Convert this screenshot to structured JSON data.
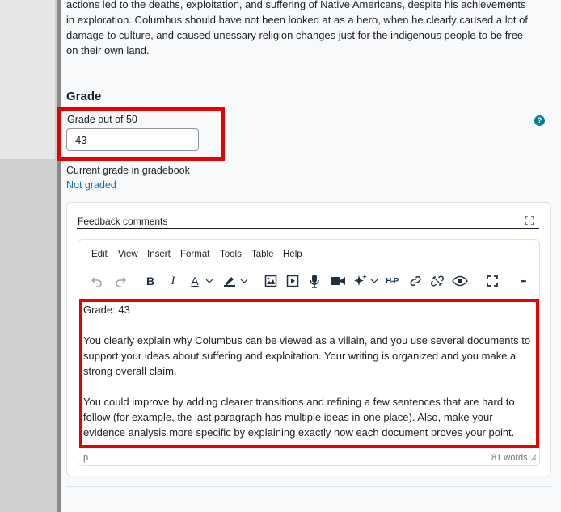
{
  "submission": {
    "text": "actions led to the deaths, exploitation, and suffering of Native Americans, despite his achievements in exploration. Columbus should have not been looked at as a hero, when he clearly caused a lot of damage to culture, and caused unessary religion changes just for the indigenous people to be free on their own land."
  },
  "grade": {
    "heading": "Grade",
    "label": "Grade out of 50",
    "value": "43",
    "help_icon": "?",
    "current_label": "Current grade in gradebook",
    "current_value": "Not graded"
  },
  "feedback": {
    "title": "Feedback comments",
    "menu": [
      "Edit",
      "View",
      "Insert",
      "Format",
      "Tools",
      "Table",
      "Help"
    ],
    "toolbar_icons": [
      "undo-icon",
      "redo-icon",
      "bold-icon",
      "italic-icon",
      "text-color-icon",
      "highlight-color-icon",
      "image-icon",
      "media-icon",
      "microphone-icon",
      "video-icon",
      "ai-sparkle-icon",
      "h5p-icon",
      "link-icon",
      "unlink-icon",
      "accessibility-checker-icon",
      "fullscreen-icon",
      "more-icon"
    ],
    "toolbar_text": {
      "bold": "B",
      "italic": "I",
      "text_color": "A",
      "h5p": "H-P",
      "more": "•••"
    },
    "content": {
      "line1": "Grade: 43",
      "para1": "You clearly explain why Columbus can be viewed as a villain, and you use several documents to support your ideas about suffering and exploitation. Your writing is organized and you make a strong overall claim.",
      "para2": "You could improve by adding clearer transitions and refining a few sentences that are hard to follow (for example, the last paragraph has multiple ideas in one place). Also, make your evidence analysis more specific by explaining exactly how each document proves your point."
    },
    "status_path": "p",
    "word_count": "81 words"
  },
  "colors": {
    "highlight_box": "#e60000",
    "link": "#0f6cbf",
    "help": "#008196"
  }
}
